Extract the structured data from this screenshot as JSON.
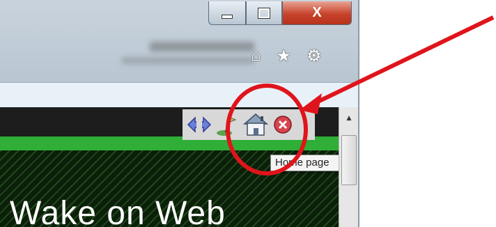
{
  "window": {
    "close_label": "X"
  },
  "toolbar": {
    "icons": [
      "home-icon",
      "star-icon",
      "gear-icon"
    ]
  },
  "page": {
    "heading": "Wake on Web"
  },
  "tooltip": {
    "text": "Home page"
  },
  "colors": {
    "annotation": "#e0141b",
    "accent_green": "#2fae38"
  }
}
